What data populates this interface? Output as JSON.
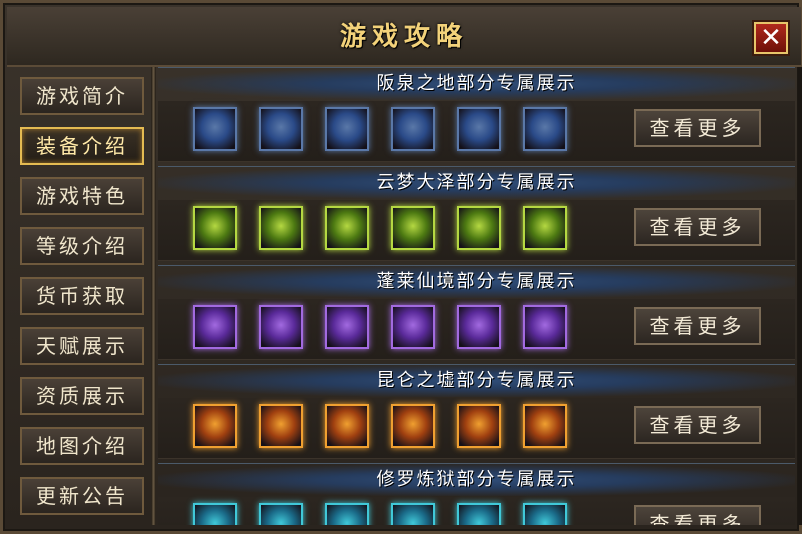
{
  "window": {
    "title": "游戏攻略",
    "close_icon": "close-icon"
  },
  "sidebar": {
    "items": [
      {
        "label": "游戏简介",
        "active": false
      },
      {
        "label": "装备介绍",
        "active": true
      },
      {
        "label": "游戏特色",
        "active": false
      },
      {
        "label": "等级介绍",
        "active": false
      },
      {
        "label": "货币获取",
        "active": false
      },
      {
        "label": "天赋展示",
        "active": false
      },
      {
        "label": "资质展示",
        "active": false
      },
      {
        "label": "地图介绍",
        "active": false
      },
      {
        "label": "更新公告",
        "active": false
      }
    ]
  },
  "sections": [
    {
      "title": "阪泉之地部分专属展示",
      "more": "查看更多",
      "frame_color": "#5a78a8",
      "glow": "#2a4a88",
      "items": [
        "green-sword-icon",
        "armor-icon",
        "gold-orb-icon",
        "amulet-icon",
        "boot-icon",
        "crystal-icon"
      ]
    },
    {
      "title": "云梦大泽部分专属展示",
      "more": "查看更多",
      "frame_color": "#b5d842",
      "glow": "#4d7a12",
      "items": [
        "green-sword-icon",
        "armor-icon",
        "helmet-icon",
        "necklace-icon",
        "bracer-icon",
        "ring-icon"
      ]
    },
    {
      "title": "蓬莱仙境部分专属展示",
      "more": "查看更多",
      "frame_color": "#a26ae0",
      "glow": "#5a2a9a",
      "items": [
        "purple-sword-icon",
        "armor-icon",
        "helmet-icon",
        "necklace-icon",
        "bracer-icon",
        "ring-icon"
      ]
    },
    {
      "title": "昆仑之墟部分专属展示",
      "more": "查看更多",
      "frame_color": "#f0a030",
      "glow": "#a04010",
      "items": [
        "orange-sword-icon",
        "armor-icon",
        "helmet-icon",
        "necklace-icon",
        "bracer-icon",
        "ring-icon"
      ]
    },
    {
      "title": "修罗炼狱部分专属展示",
      "more": "查看更多",
      "frame_color": "#40c8d8",
      "glow": "#1a6a88",
      "items": [
        "cyan-sword-icon",
        "armor-icon",
        "helmet-icon",
        "necklace-icon",
        "bracer-icon",
        "ring-icon"
      ]
    }
  ]
}
